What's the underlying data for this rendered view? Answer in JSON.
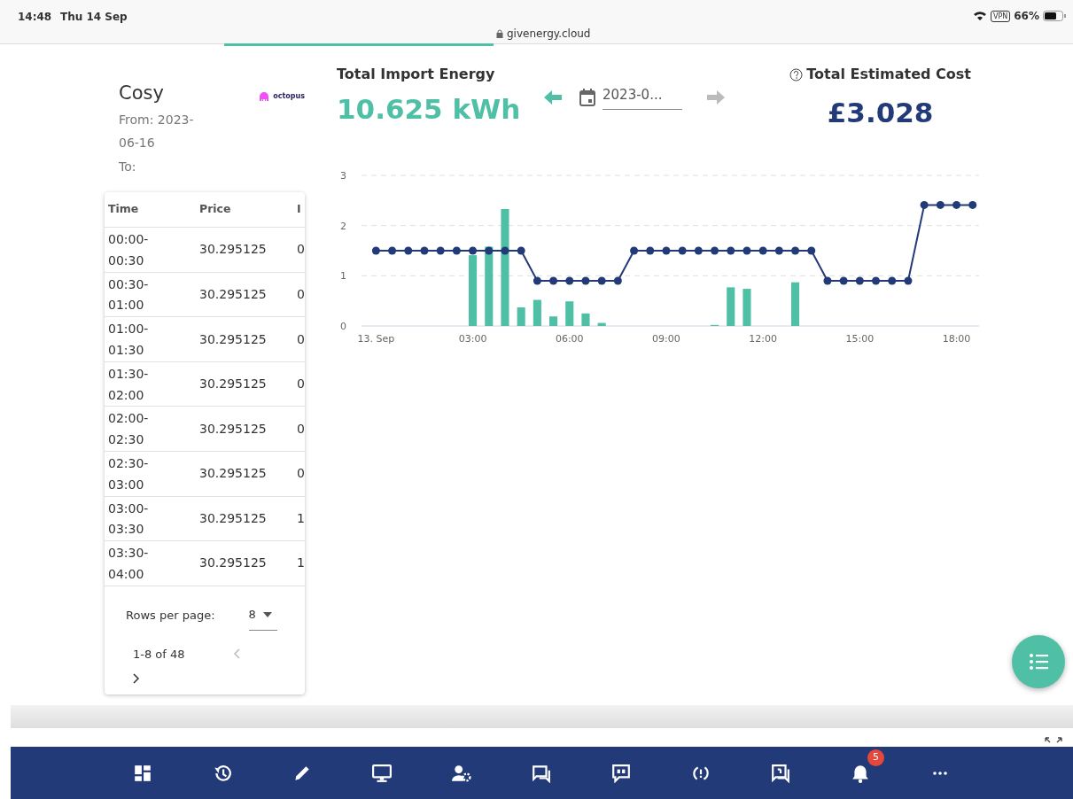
{
  "status_bar": {
    "time": "14:48",
    "date": "Thu 14 Sep",
    "url": "givenergy.cloud",
    "vpn": "VPN",
    "battery": "66%"
  },
  "tariff": {
    "name": "Cosy",
    "from": "From: 2023-06-16",
    "to": "To:",
    "logo_text": "octopus"
  },
  "table": {
    "columns": [
      "Time",
      "Price",
      "I"
    ],
    "rows": [
      [
        "00:00-00:30",
        "30.295125",
        "0"
      ],
      [
        "00:30-01:00",
        "30.295125",
        "0"
      ],
      [
        "01:00-01:30",
        "30.295125",
        "0"
      ],
      [
        "01:30-02:00",
        "30.295125",
        "0"
      ],
      [
        "02:00-02:30",
        "30.295125",
        "0"
      ],
      [
        "02:30-03:00",
        "30.295125",
        "0"
      ],
      [
        "03:00-03:30",
        "30.295125",
        "1"
      ],
      [
        "03:30-04:00",
        "30.295125",
        "1"
      ]
    ],
    "rows_per_page_label": "Rows per page:",
    "rows_per_page": "8",
    "range": "1-8 of 48",
    "prev_disabled": true,
    "next_disabled": false
  },
  "import": {
    "label": "Total Import Energy",
    "value": "10.625 kWh"
  },
  "date_nav": {
    "value": "2023-0...",
    "prev_disabled": false,
    "next_disabled": true
  },
  "cost": {
    "label": "Total Estimated Cost",
    "value": "£3.028"
  },
  "chart": {
    "chart_data": {
      "type": "bar",
      "x": [
        0,
        0.5,
        1,
        1.5,
        2,
        2.5,
        3,
        3.5,
        4,
        4.5,
        5,
        5.5,
        6,
        6.5,
        7,
        7.5,
        8,
        8.5,
        9,
        9.5,
        10,
        10.5,
        11,
        11.5,
        12,
        12.5,
        13,
        13.5,
        14,
        14.5,
        15,
        15.5,
        16,
        16.5,
        17,
        17.5,
        18,
        18.5
      ],
      "series": [
        {
          "color": "#4fbfa5",
          "values": [
            0,
            0,
            0,
            0,
            0,
            0,
            1.41,
            1.58,
            2.33,
            0.37,
            0.52,
            0.19,
            0.49,
            0.25,
            0.06,
            0,
            0,
            0,
            0,
            0,
            0,
            0.02,
            0.77,
            0.74,
            0,
            0,
            0.87,
            0,
            0,
            0,
            0,
            0,
            0,
            0,
            0,
            0,
            0,
            0
          ]
        },
        {
          "type": "line",
          "marker": "circle",
          "color": "#233a78",
          "values": [
            1.5,
            1.5,
            1.5,
            1.5,
            1.5,
            1.5,
            1.5,
            1.5,
            1.5,
            1.5,
            0.9,
            0.9,
            0.9,
            0.9,
            0.9,
            0.9,
            1.5,
            1.5,
            1.5,
            1.5,
            1.5,
            1.5,
            1.5,
            1.5,
            1.5,
            1.5,
            1.5,
            1.5,
            0.9,
            0.9,
            0.9,
            0.9,
            0.9,
            0.9,
            2.41,
            2.41,
            2.41,
            2.41
          ]
        }
      ],
      "xlim": [
        -0.45,
        18.7
      ],
      "ylim": [
        0,
        3
      ],
      "xticks": [
        {
          "value": 0,
          "label": "13. Sep"
        },
        {
          "value": 3,
          "label": "03:00"
        },
        {
          "value": 6,
          "label": "06:00"
        },
        {
          "value": 9,
          "label": "09:00"
        },
        {
          "value": 12,
          "label": "12:00"
        },
        {
          "value": 15,
          "label": "15:00"
        },
        {
          "value": 18,
          "label": "18:00"
        }
      ],
      "yticks": [
        0,
        1,
        2,
        3
      ]
    }
  },
  "taskbar": {
    "items": [
      {
        "kind": "dashboard"
      },
      {
        "kind": "history"
      },
      {
        "kind": "pencil"
      },
      {
        "kind": "monitor"
      },
      {
        "kind": "user-gear"
      },
      {
        "kind": "chat"
      },
      {
        "kind": "quote"
      },
      {
        "kind": "sync"
      },
      {
        "kind": "question"
      },
      {
        "kind": "bell",
        "badge": "5"
      },
      {
        "kind": "more"
      }
    ]
  }
}
